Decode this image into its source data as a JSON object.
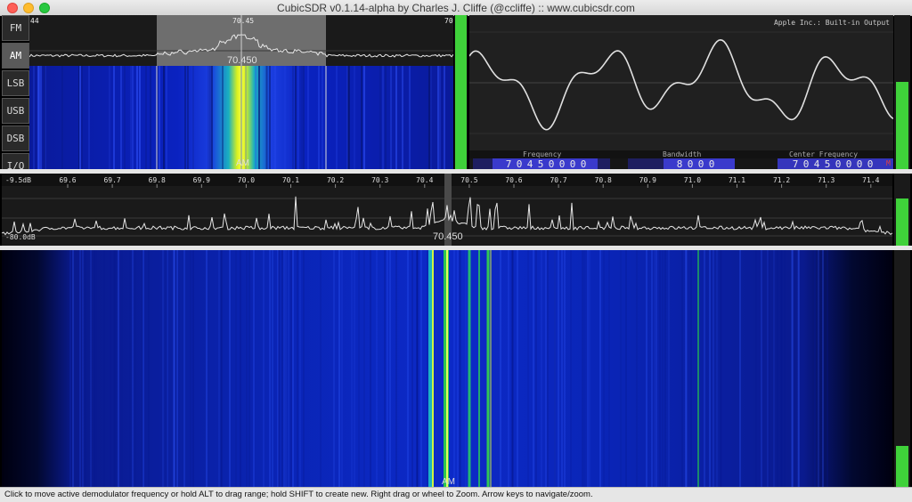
{
  "window": {
    "title": "CubicSDR v0.1.14-alpha by Charles J. Cliffe (@ccliffe)  ::  www.cubicsdr.com"
  },
  "modes": [
    {
      "label": "FM",
      "active": false
    },
    {
      "label": "AM",
      "active": true
    },
    {
      "label": "LSB",
      "active": false
    },
    {
      "label": "USB",
      "active": false
    },
    {
      "label": "DSB",
      "active": false
    },
    {
      "label": "I/Q",
      "active": false
    }
  ],
  "top_spectrum": {
    "left_tick": "44",
    "center_tick": "70.45",
    "right_tick": "70",
    "marker_freq": "70.450",
    "mode_tag": "AM"
  },
  "scope": {
    "output_device": "Apple Inc.: Built-in Output"
  },
  "digits": {
    "frequency_label": "Frequency",
    "frequency_value": "70450000",
    "bandwidth_label": "Bandwidth",
    "bandwidth_value": "8000",
    "center_label": "Center Frequency",
    "center_value": "70450000",
    "m_indicator": "M"
  },
  "main_spectrum": {
    "top_db": "-9.5dB",
    "bottom_db": "-80.0dB",
    "ticks": [
      "69.6",
      "69.7",
      "69.8",
      "69.9",
      "70.0",
      "70.1",
      "70.2",
      "70.3",
      "70.4",
      "70.5",
      "70.6",
      "70.7",
      "70.8",
      "70.9",
      "71.0",
      "71.1",
      "71.2",
      "71.3",
      "71.4"
    ],
    "marker_freq": "70.450"
  },
  "main_waterfall": {
    "mode_tag": "AM"
  },
  "status_bar": {
    "text": "Click to move active demodulator frequency or hold ALT to drag range; hold SHIFT to create new.  Right drag or wheel to Zoom.  Arrow keys to navigate/zoom."
  },
  "colors": {
    "accent_green": "#3fd13a",
    "waterfall_blue": "#0a1fb0",
    "digit_bg": "#3a3acc"
  }
}
